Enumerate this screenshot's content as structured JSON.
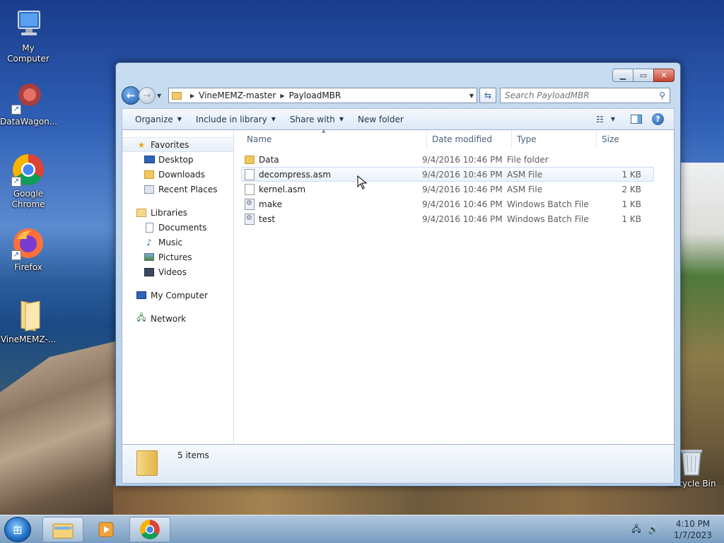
{
  "desktop": {
    "icons": [
      {
        "label": "My Computer"
      },
      {
        "label": "DataWagon..."
      },
      {
        "label": "Google Chrome"
      },
      {
        "label": "Firefox"
      },
      {
        "label": "VineMEMZ-..."
      },
      {
        "label": "Recycle Bin"
      }
    ]
  },
  "window": {
    "breadcrumb": [
      "VineMEMZ-master",
      "PayloadMBR"
    ],
    "search_placeholder": "Search PayloadMBR",
    "commands": {
      "organize": "Organize",
      "include_in_library": "Include in library",
      "share_with": "Share with",
      "new_folder": "New folder"
    },
    "nav": {
      "favorites": "Favorites",
      "desktop": "Desktop",
      "downloads": "Downloads",
      "recent_places": "Recent Places",
      "libraries": "Libraries",
      "documents": "Documents",
      "music": "Music",
      "pictures": "Pictures",
      "videos": "Videos",
      "my_computer": "My Computer",
      "network": "Network"
    },
    "columns": {
      "name": "Name",
      "date": "Date modified",
      "type": "Type",
      "size": "Size"
    },
    "files": [
      {
        "name": "Data",
        "date": "9/4/2016 10:46 PM",
        "type": "File folder",
        "size": ""
      },
      {
        "name": "decompress.asm",
        "date": "9/4/2016 10:46 PM",
        "type": "ASM File",
        "size": "1 KB"
      },
      {
        "name": "kernel.asm",
        "date": "9/4/2016 10:46 PM",
        "type": "ASM File",
        "size": "2 KB"
      },
      {
        "name": "make",
        "date": "9/4/2016 10:46 PM",
        "type": "Windows Batch File",
        "size": "1 KB"
      },
      {
        "name": "test",
        "date": "9/4/2016 10:46 PM",
        "type": "Windows Batch File",
        "size": "1 KB"
      }
    ],
    "status": "5 items"
  },
  "taskbar": {
    "time": "4:10 PM",
    "date": "1/7/2023"
  }
}
